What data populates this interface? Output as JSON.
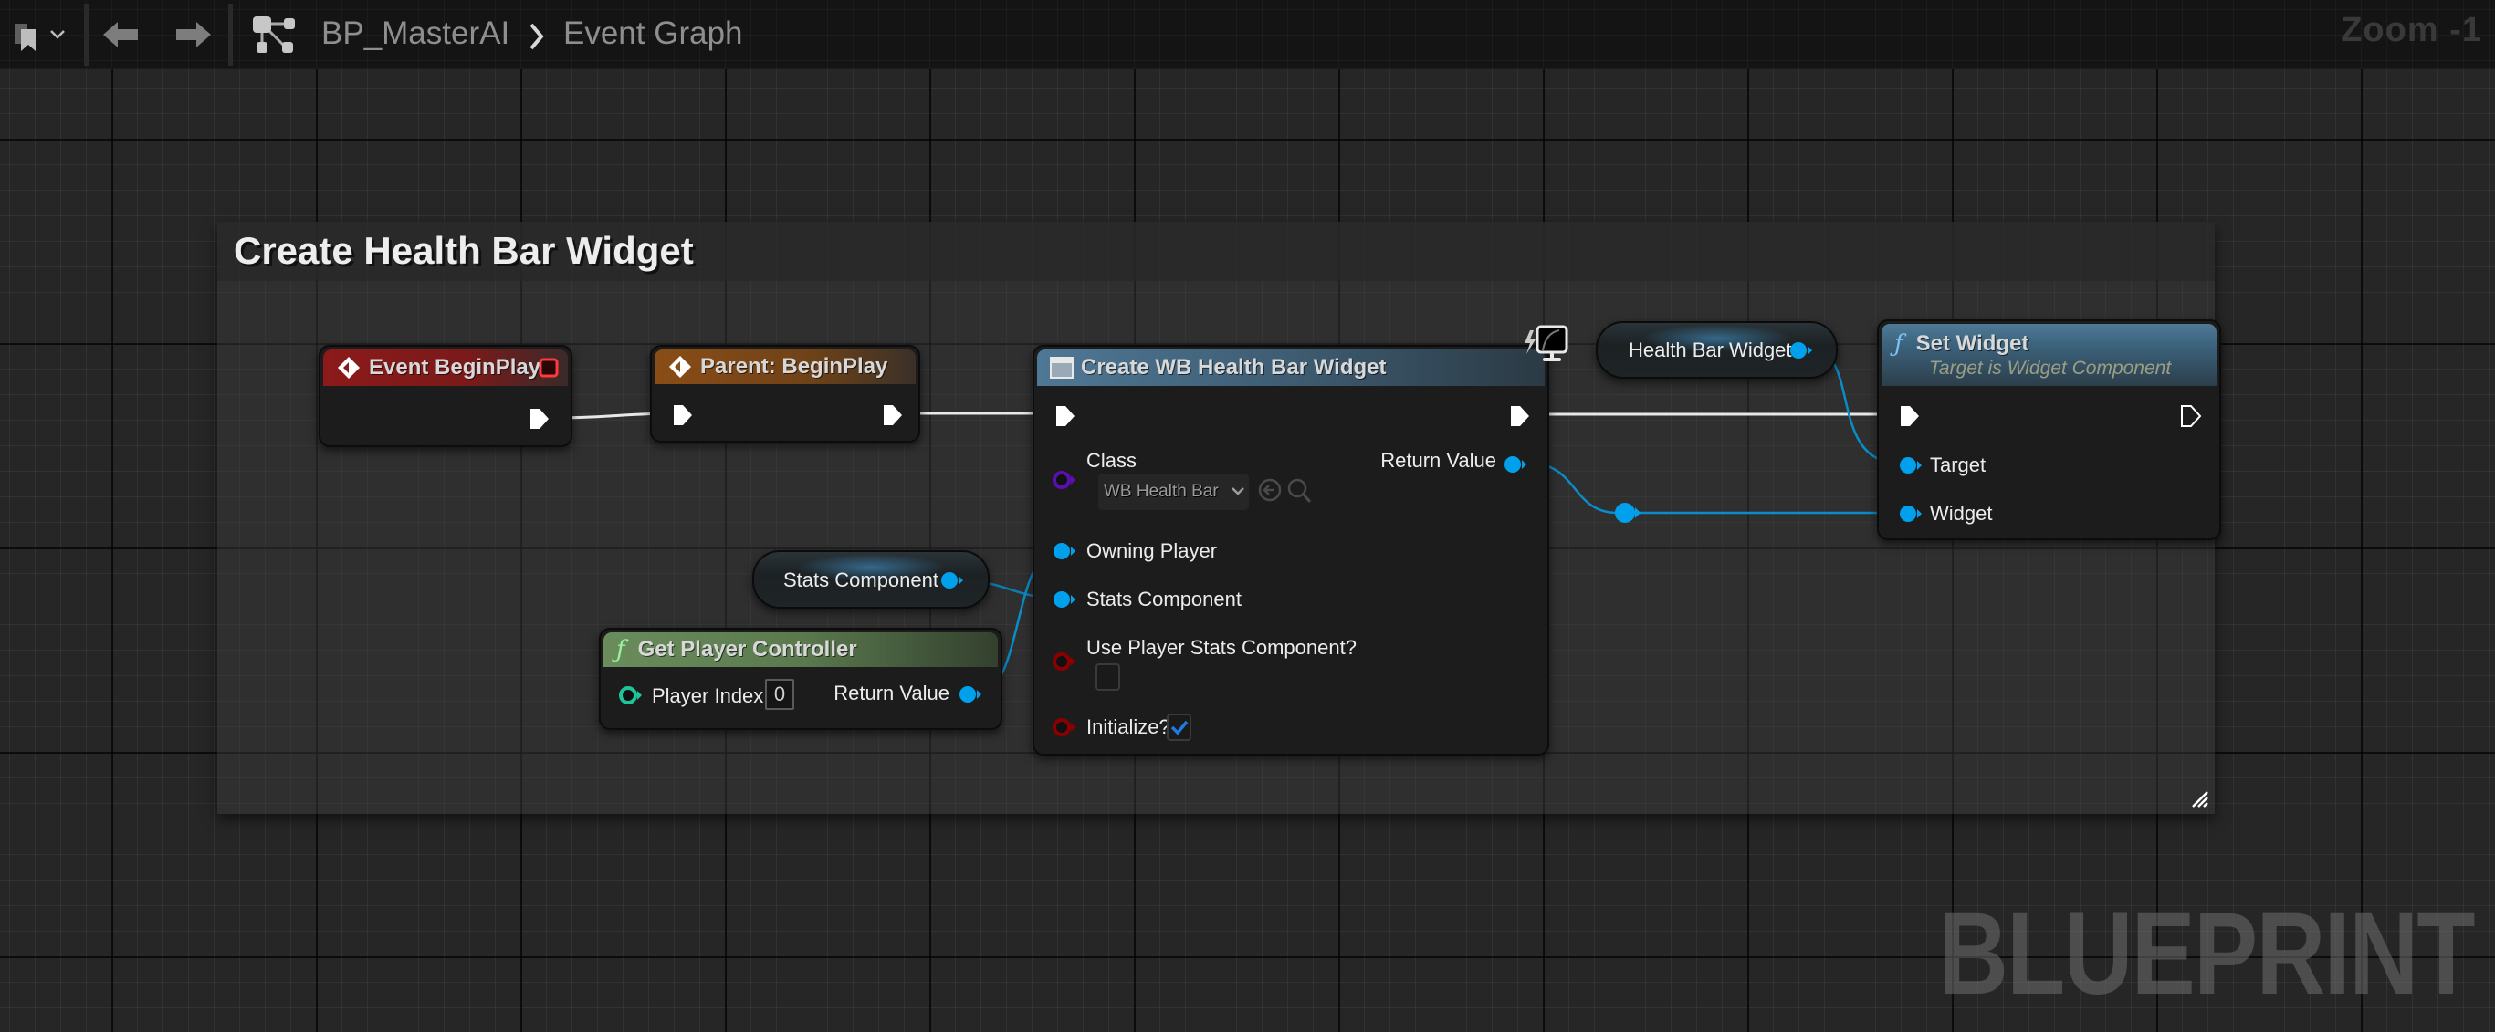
{
  "toolbar": {
    "bookmark_icon": "bookmark-icon",
    "bookmark_dropdown_icon": "chevron-down-icon",
    "back_icon": "arrow-left-icon",
    "forward_icon": "arrow-right-icon",
    "graph_icon": "graph-hierarchy-icon",
    "breadcrumb": [
      {
        "label": "BP_MasterAI"
      },
      {
        "label": "Event Graph"
      }
    ],
    "breadcrumb_separator_icon": "chevron-right-icon",
    "zoom_label": "Zoom -1"
  },
  "comment": {
    "title": "Create Health Bar Widget"
  },
  "nodes": {
    "event_begin_play": {
      "title": "Event BeginPlay",
      "icon": "event-diamond-icon",
      "header_color": "#8c1a1a",
      "delegate_icon": "delegate-pin-icon"
    },
    "parent_begin_play": {
      "title": "Parent: BeginPlay",
      "icon": "event-diamond-icon",
      "header_color": "#8a4d16"
    },
    "create_widget": {
      "title": "Create WB Health Bar Widget",
      "icon": "widget-window-icon",
      "header_color": "#3e5c72",
      "badge_icon": "client-monitor-icon",
      "pins": {
        "class_label": "Class",
        "class_value": "WB Health Bar",
        "return_value": "Return Value",
        "owning_player": "Owning Player",
        "stats_component": "Stats Component",
        "use_player_stats": "Use Player Stats Component?",
        "use_player_stats_checked": false,
        "initialize": "Initialize?",
        "initialize_checked": true
      }
    },
    "health_bar_widget_var": {
      "label": "Health Bar Widget"
    },
    "set_widget": {
      "title": "Set Widget",
      "subtitle": "Target is Widget Component",
      "icon": "function-icon",
      "header_color": "#3d6580",
      "pins": {
        "target": "Target",
        "widget": "Widget"
      }
    },
    "stats_component_var": {
      "label": "Stats Component"
    },
    "get_player_controller": {
      "title": "Get Player Controller",
      "icon": "function-icon",
      "header_color": "#5a7a4e",
      "pins": {
        "player_index": "Player Index",
        "player_index_value": "0",
        "return_value": "Return Value"
      }
    }
  },
  "colors": {
    "object_pin": "#00a0ec",
    "class_pin": "#5b0fb0",
    "bool_pin": "#8a0000",
    "int_pin": "#1fc49a",
    "exec_pin": "#ffffff",
    "check_mark": "#1f7ae0"
  },
  "watermark": "BLUEPRINT"
}
